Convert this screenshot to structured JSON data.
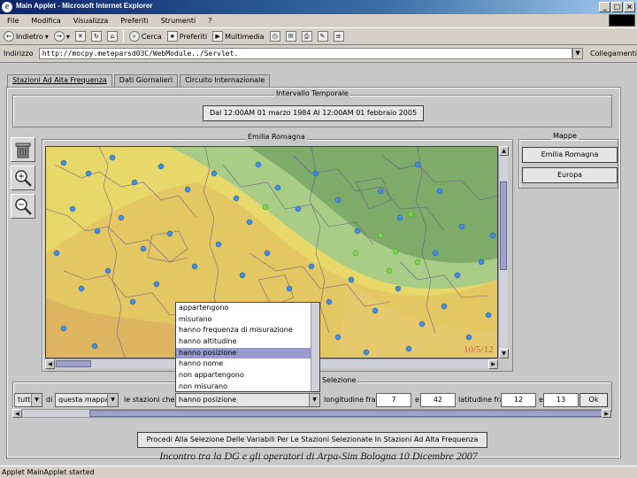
{
  "window": {
    "title": "Main Applet - Microsoft Internet Explorer"
  },
  "menu": [
    "File",
    "Modifica",
    "Visualizza",
    "Preferiti",
    "Strumenti",
    "?"
  ],
  "toolbar": {
    "back": "Indietro",
    "search": "Cerca",
    "favorites": "Preferiti",
    "multimedia": "Multimedia"
  },
  "address": {
    "label": "Indirizzo",
    "value": "http://mocpy.meteparsd03C/WebModule../Servlet.",
    "links": "Collegamenti"
  },
  "tabs": [
    {
      "label": "Stazioni Ad Alta Frequenza",
      "active": true
    },
    {
      "label": "Dati Giornalieri",
      "active": false
    },
    {
      "label": "Circuito Internazionale",
      "active": false
    }
  ],
  "intervallo": {
    "title": "Intervallo Temporale",
    "value": "Dal 12:00AM 01 marzo 1984 Al 12:00AM 01 febbraio 2005"
  },
  "mappa": {
    "title": "Emilia Romagna",
    "watermark": "10/5/12"
  },
  "mappe": {
    "title": "Mappe",
    "buttons": [
      "Emilia Romagna",
      "Europa"
    ]
  },
  "tools": {
    "trash": "trash-icon",
    "zoom_in": "zoom-in-icon",
    "zoom_out": "zoom-out-icon"
  },
  "dropdown_options": [
    "appartengono",
    "misurano",
    "hanno frequenza di misurazione",
    "hanno altitudine",
    "hanno posizione",
    "hanno nome",
    "non appartengono",
    "non misurano"
  ],
  "dropdown_selected_index": 4,
  "selezione": {
    "title": "Selezione",
    "combo1": "tutte",
    "di_label": "di",
    "combo2": "questa mappa",
    "stations_label": "le stazioni che",
    "combo3": "hanno posizione",
    "lon_label": "longitudine fra",
    "lon_from": "7",
    "e1": "e",
    "lon_to": "42",
    "lat_label": "latitudine fra",
    "lat_from": "12",
    "e2": "e",
    "lat_to": "13",
    "ok": "Ok"
  },
  "proceed": "Procedi Alla Selezione Delle Variabili Per Le Stazioni Selezionate In Stazioni Ad Alta Frequenza",
  "status": "Applet MainApplet started",
  "caption": "Incontro tra la DG e gli operatori di Arpa-Sim    Bologna 10 Dicembre 2007",
  "colors": {
    "selection": "#9a9ad0",
    "station_blue": "#3d8fe0",
    "station_green": "#7ad84a",
    "plain": "#e8d86a",
    "hills": "#9ec87a"
  }
}
